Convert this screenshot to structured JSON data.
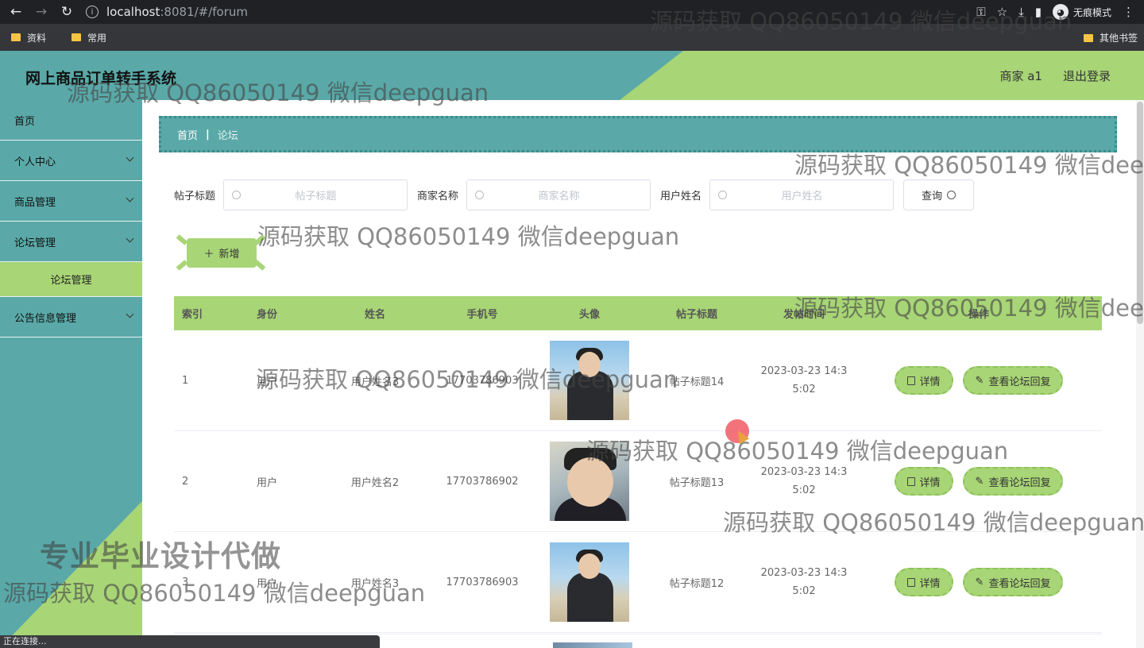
{
  "browser": {
    "url_host": "localhost",
    "url_path": ":8081/#/forum",
    "incognito_label": "无痕模式",
    "bookmarks": [
      "资料",
      "常用"
    ],
    "other_bookmarks": "其他书签"
  },
  "header": {
    "title": "网上商品订单转手系统",
    "user": "商家 a1",
    "logout": "退出登录"
  },
  "sidebar": {
    "items": [
      {
        "label": "首页"
      },
      {
        "label": "个人中心"
      },
      {
        "label": "商品管理"
      },
      {
        "label": "论坛管理"
      },
      {
        "label": "论坛管理"
      },
      {
        "label": "公告信息管理"
      }
    ]
  },
  "breadcrumb": {
    "home": "首页",
    "current": "论坛"
  },
  "search": {
    "title_label": "帖子标题",
    "title_placeholder": "帖子标题",
    "merchant_label": "商家名称",
    "merchant_placeholder": "商家名称",
    "user_label": "用户姓名",
    "user_placeholder": "用户姓名",
    "query": "查询"
  },
  "add_label": "新增",
  "table": {
    "headers": [
      "索引",
      "身份",
      "姓名",
      "手机号",
      "头像",
      "帖子标题",
      "发帖时间",
      "操作"
    ],
    "rows": [
      {
        "index": "1",
        "role": "用户",
        "name": "用户姓名3",
        "phone": "17703786903",
        "title": "帖子标题14",
        "time": "2023-03-23 14:35:02"
      },
      {
        "index": "2",
        "role": "用户",
        "name": "用户姓名2",
        "phone": "17703786902",
        "title": "帖子标题13",
        "time": "2023-03-23 14:35:02"
      },
      {
        "index": "3",
        "role": "用户",
        "name": "用户姓名3",
        "phone": "17703786903",
        "title": "帖子标题12",
        "time": "2023-03-23 14:35:02"
      }
    ],
    "detail": "详情",
    "reply": "查看论坛回复"
  },
  "status_text": "正在连接...",
  "watermarks": {
    "a": "源码获取 QQ86050149 微信deepguan",
    "b": "源码获取 QQ86050149 微信dee",
    "big": "专业毕业设计代做"
  },
  "colors": {
    "teal": "#5aa9a8",
    "green": "#a8d576"
  }
}
